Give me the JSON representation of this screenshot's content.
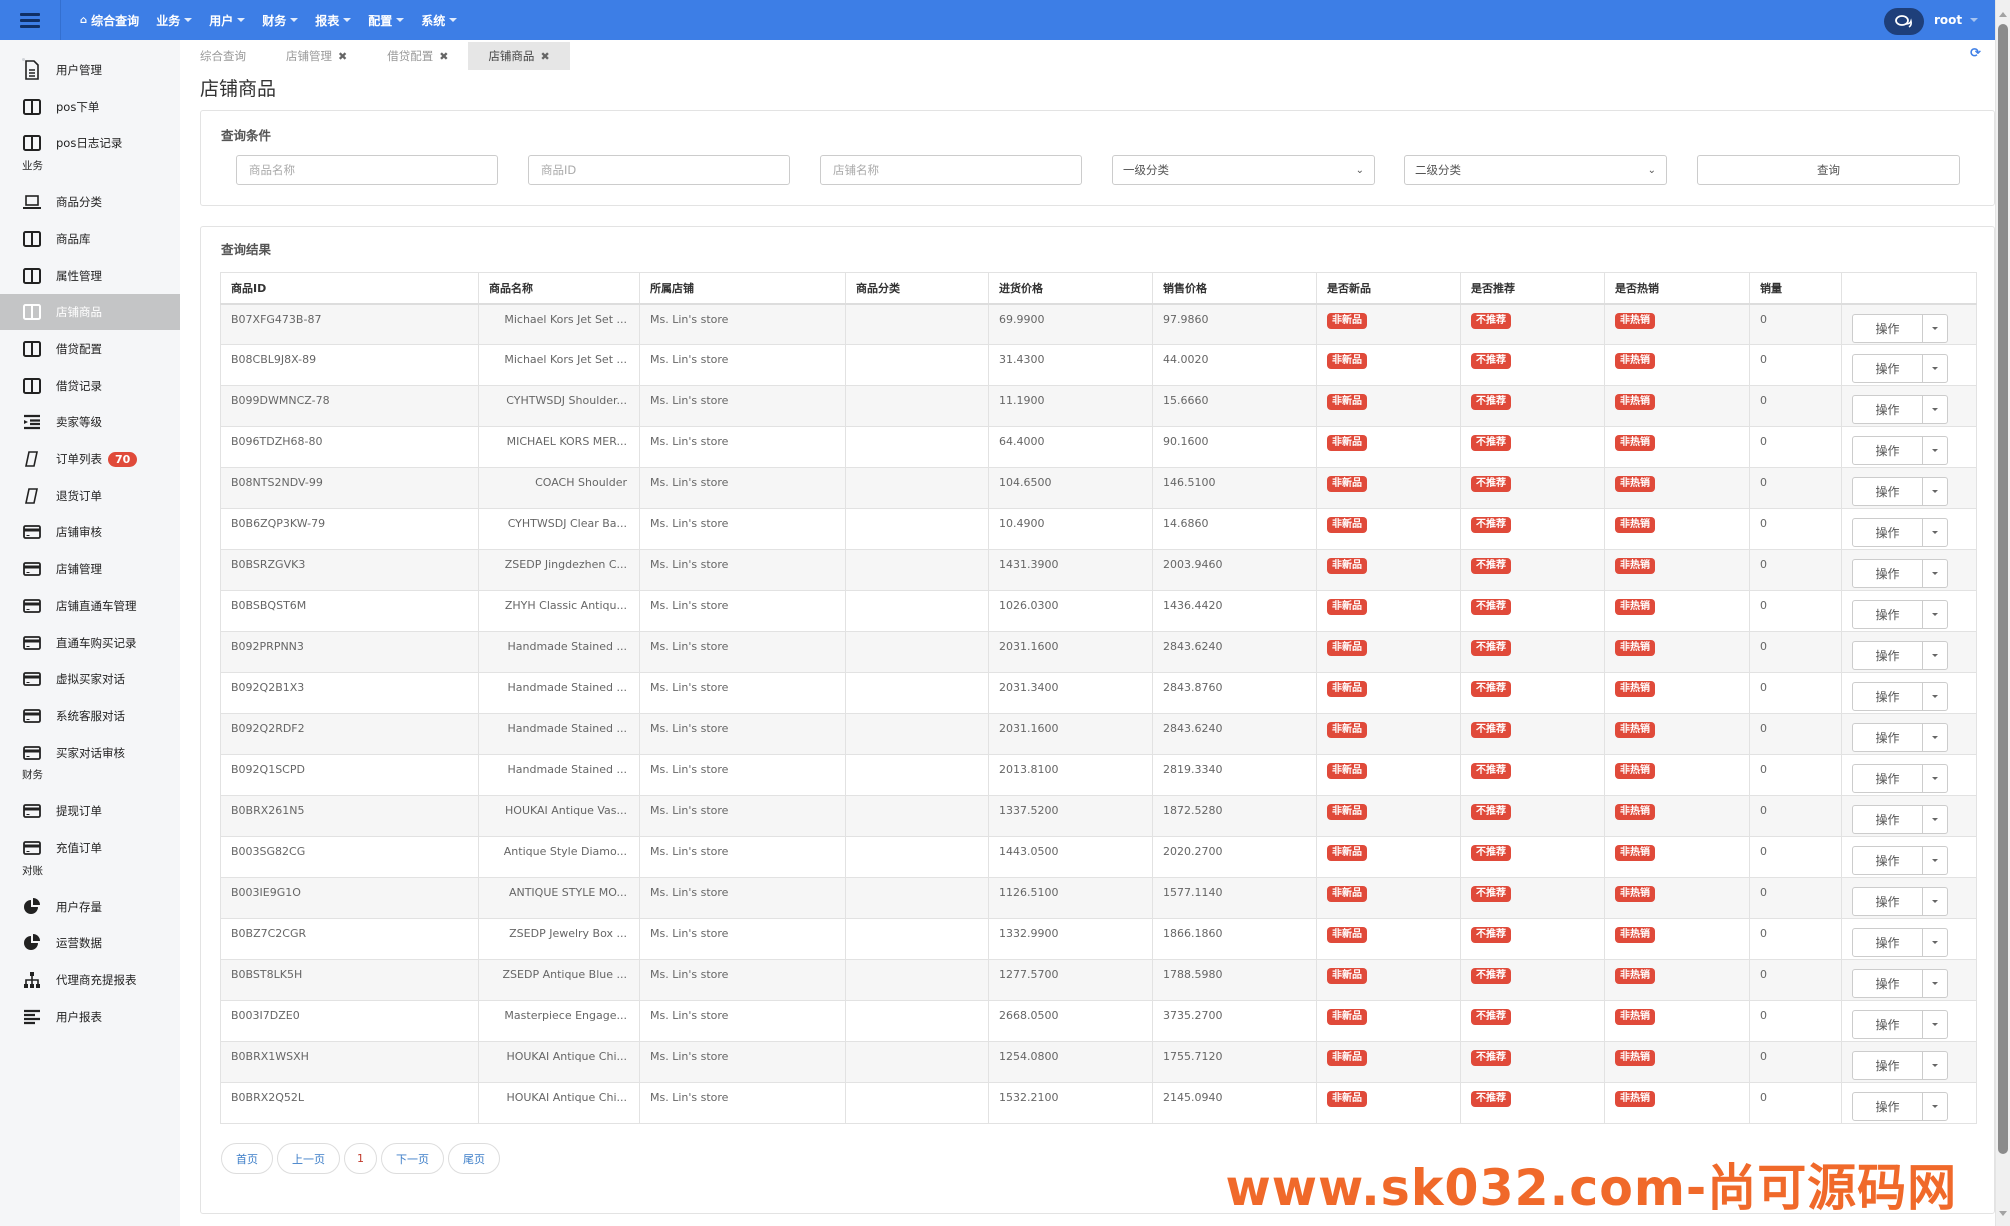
{
  "topbar": {
    "menu": [
      {
        "label": "综合查询",
        "icon": "home-icon",
        "caret": false
      },
      {
        "label": "业务",
        "caret": true
      },
      {
        "label": "用户",
        "caret": true
      },
      {
        "label": "财务",
        "caret": true
      },
      {
        "label": "报表",
        "caret": true
      },
      {
        "label": "配置",
        "caret": true
      },
      {
        "label": "系统",
        "caret": true
      }
    ],
    "user": "root",
    "accent": "#3d7ee6"
  },
  "sidebar": {
    "items": [
      {
        "label": "用户管理",
        "icon": "file-text-icon"
      },
      {
        "label": "pos下单",
        "icon": "columns-icon"
      },
      {
        "label": "pos日志记录",
        "icon": "columns-icon"
      },
      {
        "group": "业务"
      },
      {
        "label": "商品分类",
        "icon": "laptop-icon"
      },
      {
        "label": "商品库",
        "icon": "columns-icon"
      },
      {
        "label": "属性管理",
        "icon": "columns-icon"
      },
      {
        "label": "店铺商品",
        "icon": "columns-icon",
        "active": true
      },
      {
        "label": "借贷配置",
        "icon": "columns-icon"
      },
      {
        "label": "借贷记录",
        "icon": "columns-icon"
      },
      {
        "label": "卖家等级",
        "icon": "indent-icon"
      },
      {
        "label": "订单列表",
        "icon": "parallelogram-icon",
        "badge": "70"
      },
      {
        "label": "退货订单",
        "icon": "parallelogram-icon"
      },
      {
        "label": "店铺审核",
        "icon": "credit-card-icon"
      },
      {
        "label": "店铺管理",
        "icon": "credit-card-icon"
      },
      {
        "label": "店铺直通车管理",
        "icon": "credit-card-icon"
      },
      {
        "label": "直通车购买记录",
        "icon": "credit-card-icon"
      },
      {
        "label": "虚拟买家对话",
        "icon": "credit-card-icon"
      },
      {
        "label": "系统客服对话",
        "icon": "credit-card-icon"
      },
      {
        "label": "买家对话审核",
        "icon": "credit-card-icon"
      },
      {
        "group": "财务"
      },
      {
        "label": "提现订单",
        "icon": "credit-card-icon"
      },
      {
        "label": "充值订单",
        "icon": "credit-card-icon"
      },
      {
        "group": "对账"
      },
      {
        "label": "用户存量",
        "icon": "pie-chart-icon"
      },
      {
        "label": "运营数据",
        "icon": "pie-chart-icon"
      },
      {
        "label": "代理商充提报表",
        "icon": "sitemap-icon"
      },
      {
        "label": "用户报表",
        "icon": "align-left-icon"
      }
    ]
  },
  "tabs": [
    {
      "label": "综合查询",
      "closable": false,
      "active": false
    },
    {
      "label": "店铺管理",
      "closable": true,
      "active": false
    },
    {
      "label": "借贷配置",
      "closable": true,
      "active": false
    },
    {
      "label": "店铺商品",
      "closable": true,
      "active": true
    }
  ],
  "page_title": "店铺商品",
  "query": {
    "title": "查询条件",
    "product_name_placeholder": "商品名称",
    "product_id_placeholder": "商品ID",
    "store_name_placeholder": "店铺名称",
    "category1": "一级分类",
    "category2": "二级分类",
    "search_label": "查询"
  },
  "results": {
    "title": "查询结果",
    "columns": [
      "商品ID",
      "商品名称",
      "所属店铺",
      "商品分类",
      "进货价格",
      "销售价格",
      "是否新品",
      "是否推荐",
      "是否热销",
      "销量",
      ""
    ],
    "action_label": "操作",
    "rows": [
      {
        "id": "B07XFG473B-87",
        "name": "Michael Kors Jet Set ...",
        "store": "Ms. Lin's store",
        "category": "",
        "cost": "69.9900",
        "price": "97.9860",
        "new": "非新品",
        "rec": "不推荐",
        "hot": "非热销",
        "sales": "0"
      },
      {
        "id": "B08CBL9J8X-89",
        "name": "Michael Kors Jet Set ...",
        "store": "Ms. Lin's store",
        "category": "",
        "cost": "31.4300",
        "price": "44.0020",
        "new": "非新品",
        "rec": "不推荐",
        "hot": "非热销",
        "sales": "0"
      },
      {
        "id": "B099DWMNCZ-78",
        "name": "CYHTWSDJ Shoulder...",
        "store": "Ms. Lin's store",
        "category": "",
        "cost": "11.1900",
        "price": "15.6660",
        "new": "非新品",
        "rec": "不推荐",
        "hot": "非热销",
        "sales": "0"
      },
      {
        "id": "B096TDZH68-80",
        "name": "MICHAEL KORS MER...",
        "store": "Ms. Lin's store",
        "category": "",
        "cost": "64.4000",
        "price": "90.1600",
        "new": "非新品",
        "rec": "不推荐",
        "hot": "非热销",
        "sales": "0"
      },
      {
        "id": "B08NTS2NDV-99",
        "name": "COACH Shoulder",
        "store": "Ms. Lin's store",
        "category": "",
        "cost": "104.6500",
        "price": "146.5100",
        "new": "非新品",
        "rec": "不推荐",
        "hot": "非热销",
        "sales": "0"
      },
      {
        "id": "B0B6ZQP3KW-79",
        "name": "CYHTWSDJ Clear Ba...",
        "store": "Ms. Lin's store",
        "category": "",
        "cost": "10.4900",
        "price": "14.6860",
        "new": "非新品",
        "rec": "不推荐",
        "hot": "非热销",
        "sales": "0"
      },
      {
        "id": "B0BSRZGVK3",
        "name": "ZSEDP Jingdezhen C...",
        "store": "Ms. Lin's store",
        "category": "",
        "cost": "1431.3900",
        "price": "2003.9460",
        "new": "非新品",
        "rec": "不推荐",
        "hot": "非热销",
        "sales": "0"
      },
      {
        "id": "B0BSBQST6M",
        "name": "ZHYH Classic Antiqu...",
        "store": "Ms. Lin's store",
        "category": "",
        "cost": "1026.0300",
        "price": "1436.4420",
        "new": "非新品",
        "rec": "不推荐",
        "hot": "非热销",
        "sales": "0"
      },
      {
        "id": "B092PRPNN3",
        "name": "Handmade Stained ...",
        "store": "Ms. Lin's store",
        "category": "",
        "cost": "2031.1600",
        "price": "2843.6240",
        "new": "非新品",
        "rec": "不推荐",
        "hot": "非热销",
        "sales": "0"
      },
      {
        "id": "B092Q2B1X3",
        "name": "Handmade Stained ...",
        "store": "Ms. Lin's store",
        "category": "",
        "cost": "2031.3400",
        "price": "2843.8760",
        "new": "非新品",
        "rec": "不推荐",
        "hot": "非热销",
        "sales": "0"
      },
      {
        "id": "B092Q2RDF2",
        "name": "Handmade Stained ...",
        "store": "Ms. Lin's store",
        "category": "",
        "cost": "2031.1600",
        "price": "2843.6240",
        "new": "非新品",
        "rec": "不推荐",
        "hot": "非热销",
        "sales": "0"
      },
      {
        "id": "B092Q1SCPD",
        "name": "Handmade Stained ...",
        "store": "Ms. Lin's store",
        "category": "",
        "cost": "2013.8100",
        "price": "2819.3340",
        "new": "非新品",
        "rec": "不推荐",
        "hot": "非热销",
        "sales": "0"
      },
      {
        "id": "B0BRX261N5",
        "name": "HOUKAI Antique Vas...",
        "store": "Ms. Lin's store",
        "category": "",
        "cost": "1337.5200",
        "price": "1872.5280",
        "new": "非新品",
        "rec": "不推荐",
        "hot": "非热销",
        "sales": "0"
      },
      {
        "id": "B003SG82CG",
        "name": "Antique Style Diamo...",
        "store": "Ms. Lin's store",
        "category": "",
        "cost": "1443.0500",
        "price": "2020.2700",
        "new": "非新品",
        "rec": "不推荐",
        "hot": "非热销",
        "sales": "0"
      },
      {
        "id": "B003IE9G1O",
        "name": "ANTIQUE STYLE MO...",
        "store": "Ms. Lin's store",
        "category": "",
        "cost": "1126.5100",
        "price": "1577.1140",
        "new": "非新品",
        "rec": "不推荐",
        "hot": "非热销",
        "sales": "0"
      },
      {
        "id": "B0BZ7C2CGR",
        "name": "ZSEDP Jewelry Box ...",
        "store": "Ms. Lin's store",
        "category": "",
        "cost": "1332.9900",
        "price": "1866.1860",
        "new": "非新品",
        "rec": "不推荐",
        "hot": "非热销",
        "sales": "0"
      },
      {
        "id": "B0BST8LK5H",
        "name": "ZSEDP Antique Blue ...",
        "store": "Ms. Lin's store",
        "category": "",
        "cost": "1277.5700",
        "price": "1788.5980",
        "new": "非新品",
        "rec": "不推荐",
        "hot": "非热销",
        "sales": "0"
      },
      {
        "id": "B003I7DZE0",
        "name": "Masterpiece Engage...",
        "store": "Ms. Lin's store",
        "category": "",
        "cost": "2668.0500",
        "price": "3735.2700",
        "new": "非新品",
        "rec": "不推荐",
        "hot": "非热销",
        "sales": "0"
      },
      {
        "id": "B0BRX1WSXH",
        "name": "HOUKAI Antique Chi...",
        "store": "Ms. Lin's store",
        "category": "",
        "cost": "1254.0800",
        "price": "1755.7120",
        "new": "非新品",
        "rec": "不推荐",
        "hot": "非热销",
        "sales": "0"
      },
      {
        "id": "B0BRX2Q52L",
        "name": "HOUKAI Antique Chi...",
        "store": "Ms. Lin's store",
        "category": "",
        "cost": "1532.2100",
        "price": "2145.0940",
        "new": "非新品",
        "rec": "不推荐",
        "hot": "非热销",
        "sales": "0"
      }
    ],
    "badge_color": "#e04a3a"
  },
  "pagination": {
    "first": "首页",
    "prev": "上一页",
    "current": "1",
    "next": "下一页",
    "last": "尾页"
  },
  "watermark": "www.sk032.com-尚可源码网"
}
